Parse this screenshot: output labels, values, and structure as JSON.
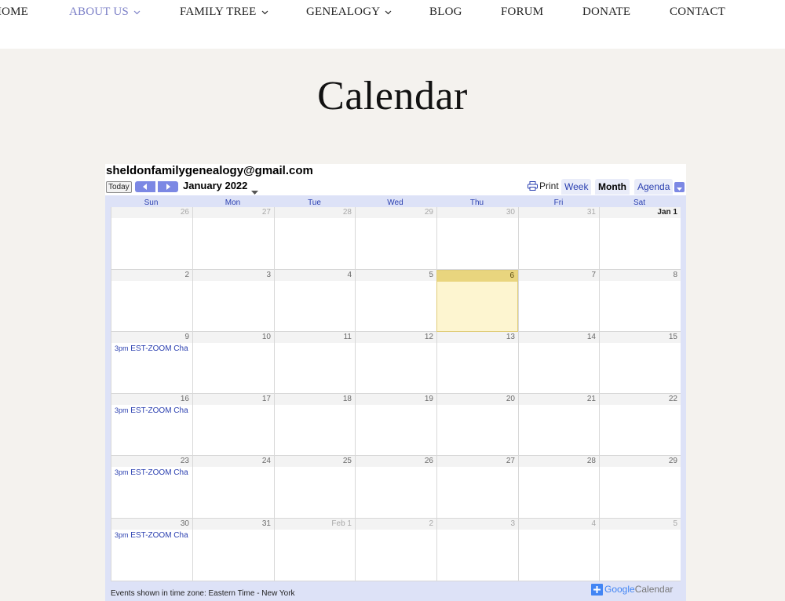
{
  "nav": {
    "items": [
      {
        "label": "HOME",
        "dropdown": false
      },
      {
        "label": "ABOUT US",
        "dropdown": true,
        "active": true
      },
      {
        "label": "FAMILY TREE",
        "dropdown": true
      },
      {
        "label": "GENEALOGY",
        "dropdown": true
      },
      {
        "label": "BLOG",
        "dropdown": false
      },
      {
        "label": "FORUM",
        "dropdown": false
      },
      {
        "label": "DONATE",
        "dropdown": false
      },
      {
        "label": "CONTACT",
        "dropdown": false
      }
    ]
  },
  "page": {
    "title": "Calendar"
  },
  "calendar": {
    "owner": "sheldonfamilygenealogy@gmail.com",
    "today_label": "Today",
    "month_label": "January 2022",
    "print_label": "Print",
    "tabs": {
      "week": "Week",
      "month": "Month",
      "agenda": "Agenda"
    },
    "days_of_week": [
      "Sun",
      "Mon",
      "Tue",
      "Wed",
      "Thu",
      "Fri",
      "Sat"
    ],
    "weeks": [
      [
        {
          "n": "26",
          "other": true
        },
        {
          "n": "27",
          "other": true
        },
        {
          "n": "28",
          "other": true
        },
        {
          "n": "29",
          "other": true
        },
        {
          "n": "30",
          "other": true
        },
        {
          "n": "31",
          "other": true
        },
        {
          "n": "Jan 1",
          "bold": true
        }
      ],
      [
        {
          "n": "2"
        },
        {
          "n": "3"
        },
        {
          "n": "4"
        },
        {
          "n": "5"
        },
        {
          "n": "6",
          "today": true
        },
        {
          "n": "7"
        },
        {
          "n": "8"
        }
      ],
      [
        {
          "n": "9",
          "event_time": "3pm",
          "event_title": "EST-ZOOM Cha"
        },
        {
          "n": "10"
        },
        {
          "n": "11"
        },
        {
          "n": "12"
        },
        {
          "n": "13"
        },
        {
          "n": "14"
        },
        {
          "n": "15"
        }
      ],
      [
        {
          "n": "16",
          "event_time": "3pm",
          "event_title": "EST-ZOOM Cha"
        },
        {
          "n": "17"
        },
        {
          "n": "18"
        },
        {
          "n": "19"
        },
        {
          "n": "20"
        },
        {
          "n": "21"
        },
        {
          "n": "22"
        }
      ],
      [
        {
          "n": "23",
          "event_time": "3pm",
          "event_title": "EST-ZOOM Cha"
        },
        {
          "n": "24"
        },
        {
          "n": "25"
        },
        {
          "n": "26"
        },
        {
          "n": "27"
        },
        {
          "n": "28"
        },
        {
          "n": "29"
        }
      ],
      [
        {
          "n": "30",
          "event_time": "3pm",
          "event_title": "EST-ZOOM Cha"
        },
        {
          "n": "31"
        },
        {
          "n": "Feb 1",
          "other": true
        },
        {
          "n": "2",
          "other": true
        },
        {
          "n": "3",
          "other": true
        },
        {
          "n": "4",
          "other": true
        },
        {
          "n": "5",
          "other": true
        }
      ]
    ],
    "timezone_note": "Events shown in time zone: Eastern Time - New York",
    "google_brand": "Google",
    "google_product": "Calendar"
  },
  "colors": {
    "accent": "#7b7fc7",
    "today_bg": "#fdf5d0",
    "link": "#2a3fb0",
    "google_blue": "#4285f4"
  }
}
